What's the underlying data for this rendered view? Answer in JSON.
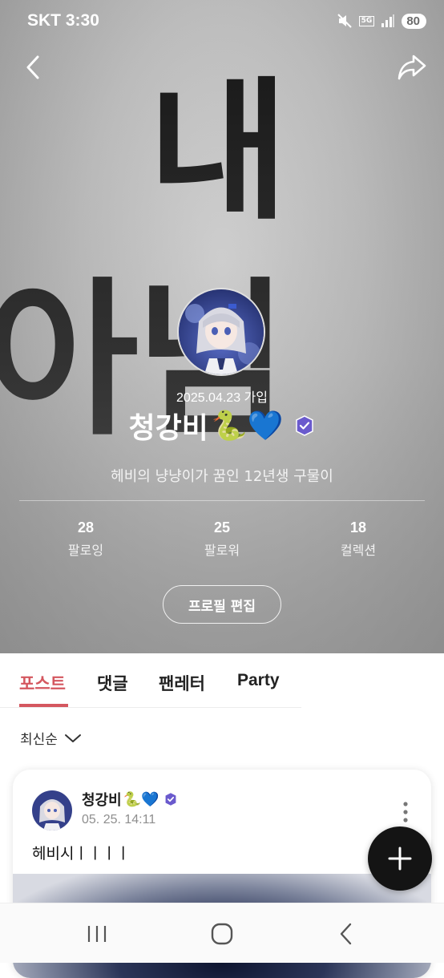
{
  "status_bar": {
    "carrier": "SKT",
    "time": "3:30",
    "network": "5G",
    "battery": "80"
  },
  "background": {
    "text_line1": "내",
    "text_line2": "아님"
  },
  "profile": {
    "join_date": "2025.04.23 가입",
    "nickname": "청강비",
    "nickname_emojis": "🐍💙",
    "bio": "헤비의 냥냥이가 꿈인 12년생 구물이",
    "stats": [
      {
        "count": "28",
        "label": "팔로잉"
      },
      {
        "count": "25",
        "label": "팔로워"
      },
      {
        "count": "18",
        "label": "컬렉션"
      }
    ],
    "edit_button": "프로필 편집"
  },
  "tabs": [
    {
      "label": "포스트",
      "active": true
    },
    {
      "label": "댓글",
      "active": false
    },
    {
      "label": "팬레터",
      "active": false
    },
    {
      "label": "Party",
      "active": false
    }
  ],
  "sort": {
    "label": "최신순"
  },
  "post": {
    "author": "청강비",
    "author_emojis": "🐍💙",
    "timestamp": "05. 25. 14:11",
    "text": "헤비시ㅣㅣㅣㅣ"
  },
  "colors": {
    "accent": "#d4575f",
    "verified_badge": "#6a5acd"
  },
  "icons": [
    "back-icon",
    "share-icon",
    "verified-badge-icon",
    "chevron-down-icon",
    "more-vert-icon",
    "plus-icon",
    "recent-apps-icon",
    "home-icon",
    "nav-back-icon"
  ]
}
